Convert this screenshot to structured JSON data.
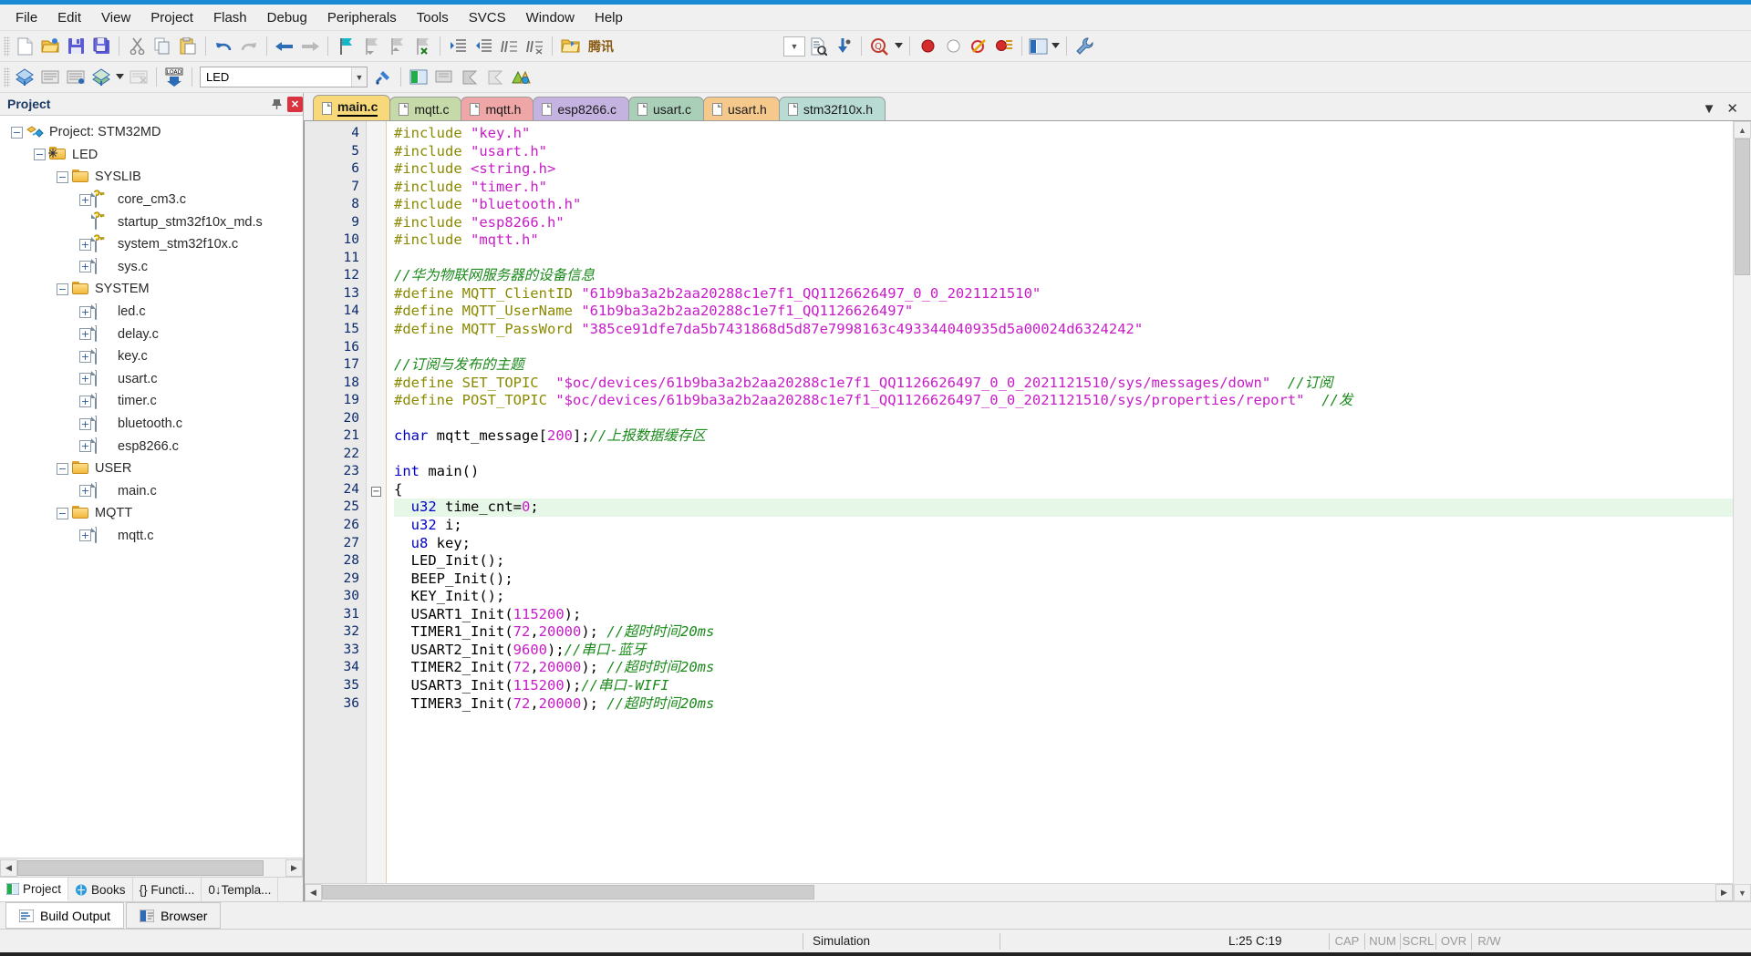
{
  "menubar": {
    "items": [
      {
        "label": "File"
      },
      {
        "label": "Edit"
      },
      {
        "label": "View"
      },
      {
        "label": "Project"
      },
      {
        "label": "Flash"
      },
      {
        "label": "Debug"
      },
      {
        "label": "Peripherals"
      },
      {
        "label": "Tools"
      },
      {
        "label": "SVCS"
      },
      {
        "label": "Window"
      },
      {
        "label": "Help"
      }
    ]
  },
  "toolbar1": {
    "icons": [
      "new-file-icon",
      "open-file-icon",
      "save-icon",
      "save-all-icon",
      "cut-icon",
      "copy-icon",
      "paste-icon",
      "undo-icon",
      "redo-icon",
      "navigate-back-icon",
      "navigate-forward-icon",
      "bookmark-toggle-icon",
      "bookmark-prev-icon",
      "bookmark-next-icon",
      "bookmark-clear-icon",
      "indent-icon",
      "outdent-icon",
      "comment-icon",
      "uncomment-icon"
    ],
    "tencent_label": "腾讯",
    "tencent_icon": "tencent-folder-icon",
    "find_combo_value": "",
    "find_in_files_icon": "find-in-files-icon",
    "bookmark-jump-icon": "goto-icon",
    "zoom_icon": "find-icon",
    "debug_icons": [
      "breakpoint-icon",
      "breakpoint-disable-icon",
      "breakpoint-kill-icon",
      "breakpoint-list-icon"
    ],
    "window_icon": "window-layout-icon",
    "config_icon": "configure-icon"
  },
  "toolbar2": {
    "icons": [
      "build-icon",
      "translate-icon",
      "build-target-icon",
      "rebuild-icon",
      "batch-build-icon",
      "download-icon"
    ],
    "target_value": "LED",
    "target_placeholder": "Select Target",
    "right_icons": [
      "project-window-icon",
      "books-icon",
      "functions-icon",
      "templates-icon",
      "manage-project-icon"
    ]
  },
  "project_panel": {
    "title": "Project",
    "pin_icon": "pin-icon",
    "close_icon": "close-icon",
    "tree": [
      {
        "depth": 0,
        "expander": "-",
        "icon": "project-icon",
        "label": "Project: STM32MD"
      },
      {
        "depth": 1,
        "expander": "-",
        "icon": "target-icon",
        "label": "LED"
      },
      {
        "depth": 2,
        "expander": "-",
        "icon": "folder-icon",
        "label": "SYSLIB"
      },
      {
        "depth": 3,
        "expander": "+",
        "icon": "source-key-icon",
        "label": "core_cm3.c"
      },
      {
        "depth": 3,
        "expander": "",
        "icon": "source-key-icon",
        "label": "startup_stm32f10x_md.s"
      },
      {
        "depth": 3,
        "expander": "+",
        "icon": "source-key-icon",
        "label": "system_stm32f10x.c"
      },
      {
        "depth": 3,
        "expander": "+",
        "icon": "source-icon",
        "label": "sys.c"
      },
      {
        "depth": 2,
        "expander": "-",
        "icon": "folder-icon",
        "label": "SYSTEM"
      },
      {
        "depth": 3,
        "expander": "+",
        "icon": "source-icon",
        "label": "led.c"
      },
      {
        "depth": 3,
        "expander": "+",
        "icon": "source-icon",
        "label": "delay.c"
      },
      {
        "depth": 3,
        "expander": "+",
        "icon": "source-icon",
        "label": "key.c"
      },
      {
        "depth": 3,
        "expander": "+",
        "icon": "source-icon",
        "label": "usart.c"
      },
      {
        "depth": 3,
        "expander": "+",
        "icon": "source-icon",
        "label": "timer.c"
      },
      {
        "depth": 3,
        "expander": "+",
        "icon": "source-icon",
        "label": "bluetooth.c"
      },
      {
        "depth": 3,
        "expander": "+",
        "icon": "source-icon",
        "label": "esp8266.c"
      },
      {
        "depth": 2,
        "expander": "-",
        "icon": "folder-icon",
        "label": "USER"
      },
      {
        "depth": 3,
        "expander": "+",
        "icon": "source-icon",
        "label": "main.c"
      },
      {
        "depth": 2,
        "expander": "-",
        "icon": "folder-icon",
        "label": "MQTT"
      },
      {
        "depth": 3,
        "expander": "+",
        "icon": "source-icon",
        "label": "mqtt.c"
      }
    ],
    "bottom_tabs": [
      {
        "label": "Project",
        "icon": "project-window-icon",
        "active": true
      },
      {
        "label": "Books",
        "icon": "books-icon",
        "active": false
      },
      {
        "label": "{} Functi...",
        "icon": "functions-icon",
        "active": false
      },
      {
        "label": "0↓Templa...",
        "icon": "templates-icon",
        "active": false
      }
    ]
  },
  "editor": {
    "tabs": [
      {
        "label": "main.c",
        "color": "#f7d97a",
        "active": true
      },
      {
        "label": "mqtt.c",
        "color": "#c6d9a8",
        "active": false
      },
      {
        "label": "mqtt.h",
        "color": "#eea6a6",
        "active": false
      },
      {
        "label": "esp8266.c",
        "color": "#c4b2e0",
        "active": false
      },
      {
        "label": "usart.c",
        "color": "#a9cfb8",
        "active": false
      },
      {
        "label": "usart.h",
        "color": "#f5c98c",
        "active": false
      },
      {
        "label": "stm32f10x.h",
        "color": "#b8dbd4",
        "active": false
      }
    ],
    "tab_close_icon": "close-icon",
    "tab_dropdown_icon": "chevron-down-icon",
    "first_line_number": 4,
    "lines": [
      {
        "n": 4,
        "fold": "",
        "cur": false,
        "tokens": [
          {
            "t": "#include ",
            "c": "k-pre"
          },
          {
            "t": "\"key.h\"",
            "c": "k-str"
          }
        ]
      },
      {
        "n": 5,
        "fold": "",
        "cur": false,
        "tokens": [
          {
            "t": "#include ",
            "c": "k-pre"
          },
          {
            "t": "\"usart.h\"",
            "c": "k-str"
          }
        ]
      },
      {
        "n": 6,
        "fold": "",
        "cur": false,
        "tokens": [
          {
            "t": "#include ",
            "c": "k-pre"
          },
          {
            "t": "<string.h>",
            "c": "k-str"
          }
        ]
      },
      {
        "n": 7,
        "fold": "",
        "cur": false,
        "tokens": [
          {
            "t": "#include ",
            "c": "k-pre"
          },
          {
            "t": "\"timer.h\"",
            "c": "k-str"
          }
        ]
      },
      {
        "n": 8,
        "fold": "",
        "cur": false,
        "tokens": [
          {
            "t": "#include ",
            "c": "k-pre"
          },
          {
            "t": "\"bluetooth.h\"",
            "c": "k-str"
          }
        ]
      },
      {
        "n": 9,
        "fold": "",
        "cur": false,
        "tokens": [
          {
            "t": "#include ",
            "c": "k-pre"
          },
          {
            "t": "\"esp8266.h\"",
            "c": "k-str"
          }
        ]
      },
      {
        "n": 10,
        "fold": "",
        "cur": false,
        "tokens": [
          {
            "t": "#include ",
            "c": "k-pre"
          },
          {
            "t": "\"mqtt.h\"",
            "c": "k-str"
          }
        ]
      },
      {
        "n": 11,
        "fold": "",
        "cur": false,
        "tokens": []
      },
      {
        "n": 12,
        "fold": "",
        "cur": false,
        "tokens": [
          {
            "t": "//华为物联网服务器的设备信息",
            "c": "k-cmt"
          }
        ]
      },
      {
        "n": 13,
        "fold": "",
        "cur": false,
        "tokens": [
          {
            "t": "#define MQTT_ClientID ",
            "c": "k-pre"
          },
          {
            "t": "\"61b9ba3a2b2aa20288c1e7f1_QQ1126626497_0_0_2021121510\"",
            "c": "k-str"
          }
        ]
      },
      {
        "n": 14,
        "fold": "",
        "cur": false,
        "tokens": [
          {
            "t": "#define MQTT_UserName ",
            "c": "k-pre"
          },
          {
            "t": "\"61b9ba3a2b2aa20288c1e7f1_QQ1126626497\"",
            "c": "k-str"
          }
        ]
      },
      {
        "n": 15,
        "fold": "",
        "cur": false,
        "tokens": [
          {
            "t": "#define MQTT_PassWord ",
            "c": "k-pre"
          },
          {
            "t": "\"385ce91dfe7da5b7431868d5d87e7998163c493344040935d5a00024d6324242\"",
            "c": "k-str"
          }
        ]
      },
      {
        "n": 16,
        "fold": "",
        "cur": false,
        "tokens": []
      },
      {
        "n": 17,
        "fold": "",
        "cur": false,
        "tokens": [
          {
            "t": "//订阅与发布的主题",
            "c": "k-cmt"
          }
        ]
      },
      {
        "n": 18,
        "fold": "",
        "cur": false,
        "tokens": [
          {
            "t": "#define SET_TOPIC  ",
            "c": "k-pre"
          },
          {
            "t": "\"$oc/devices/61b9ba3a2b2aa20288c1e7f1_QQ1126626497_0_0_2021121510/sys/messages/down\"",
            "c": "k-str"
          },
          {
            "t": "  ",
            "c": "k-txt"
          },
          {
            "t": "//订阅",
            "c": "k-cmt"
          }
        ]
      },
      {
        "n": 19,
        "fold": "",
        "cur": false,
        "tokens": [
          {
            "t": "#define POST_TOPIC ",
            "c": "k-pre"
          },
          {
            "t": "\"$oc/devices/61b9ba3a2b2aa20288c1e7f1_QQ1126626497_0_0_2021121510/sys/properties/report\"",
            "c": "k-str"
          },
          {
            "t": "  ",
            "c": "k-txt"
          },
          {
            "t": "//发",
            "c": "k-cmt"
          }
        ]
      },
      {
        "n": 20,
        "fold": "",
        "cur": false,
        "tokens": []
      },
      {
        "n": 21,
        "fold": "",
        "cur": false,
        "tokens": [
          {
            "t": "char",
            "c": "k-kw"
          },
          {
            "t": " mqtt_message[",
            "c": "k-txt"
          },
          {
            "t": "200",
            "c": "k-num"
          },
          {
            "t": "];",
            "c": "k-txt"
          },
          {
            "t": "//上报数据缓存区",
            "c": "k-cmt"
          }
        ]
      },
      {
        "n": 22,
        "fold": "",
        "cur": false,
        "tokens": []
      },
      {
        "n": 23,
        "fold": "",
        "cur": false,
        "tokens": [
          {
            "t": "int",
            "c": "k-kw"
          },
          {
            "t": " main()",
            "c": "k-txt"
          }
        ]
      },
      {
        "n": 24,
        "fold": "-",
        "cur": false,
        "tokens": [
          {
            "t": "{",
            "c": "k-txt"
          }
        ]
      },
      {
        "n": 25,
        "fold": "",
        "cur": true,
        "tokens": [
          {
            "t": "  ",
            "c": "k-txt"
          },
          {
            "t": "u32",
            "c": "k-kw"
          },
          {
            "t": " time_cnt=",
            "c": "k-txt"
          },
          {
            "t": "0",
            "c": "k-num"
          },
          {
            "t": ";",
            "c": "k-txt"
          }
        ]
      },
      {
        "n": 26,
        "fold": "",
        "cur": false,
        "tokens": [
          {
            "t": "  ",
            "c": "k-txt"
          },
          {
            "t": "u32",
            "c": "k-kw"
          },
          {
            "t": " i;",
            "c": "k-txt"
          }
        ]
      },
      {
        "n": 27,
        "fold": "",
        "cur": false,
        "tokens": [
          {
            "t": "  ",
            "c": "k-txt"
          },
          {
            "t": "u8",
            "c": "k-kw"
          },
          {
            "t": " key;",
            "c": "k-txt"
          }
        ]
      },
      {
        "n": 28,
        "fold": "",
        "cur": false,
        "tokens": [
          {
            "t": "  LED_Init();",
            "c": "k-txt"
          }
        ]
      },
      {
        "n": 29,
        "fold": "",
        "cur": false,
        "tokens": [
          {
            "t": "  BEEP_Init();",
            "c": "k-txt"
          }
        ]
      },
      {
        "n": 30,
        "fold": "",
        "cur": false,
        "tokens": [
          {
            "t": "  KEY_Init();",
            "c": "k-txt"
          }
        ]
      },
      {
        "n": 31,
        "fold": "",
        "cur": false,
        "tokens": [
          {
            "t": "  USART1_Init(",
            "c": "k-txt"
          },
          {
            "t": "115200",
            "c": "k-num"
          },
          {
            "t": ");",
            "c": "k-txt"
          }
        ]
      },
      {
        "n": 32,
        "fold": "",
        "cur": false,
        "tokens": [
          {
            "t": "  TIMER1_Init(",
            "c": "k-txt"
          },
          {
            "t": "72",
            "c": "k-num"
          },
          {
            "t": ",",
            "c": "k-txt"
          },
          {
            "t": "20000",
            "c": "k-num"
          },
          {
            "t": "); ",
            "c": "k-txt"
          },
          {
            "t": "//超时时间20ms",
            "c": "k-cmt"
          }
        ]
      },
      {
        "n": 33,
        "fold": "",
        "cur": false,
        "tokens": [
          {
            "t": "  USART2_Init(",
            "c": "k-txt"
          },
          {
            "t": "9600",
            "c": "k-num"
          },
          {
            "t": ");",
            "c": "k-txt"
          },
          {
            "t": "//串口-蓝牙",
            "c": "k-cmt"
          }
        ]
      },
      {
        "n": 34,
        "fold": "",
        "cur": false,
        "tokens": [
          {
            "t": "  TIMER2_Init(",
            "c": "k-txt"
          },
          {
            "t": "72",
            "c": "k-num"
          },
          {
            "t": ",",
            "c": "k-txt"
          },
          {
            "t": "20000",
            "c": "k-num"
          },
          {
            "t": "); ",
            "c": "k-txt"
          },
          {
            "t": "//超时时间20ms",
            "c": "k-cmt"
          }
        ]
      },
      {
        "n": 35,
        "fold": "",
        "cur": false,
        "tokens": [
          {
            "t": "  USART3_Init(",
            "c": "k-txt"
          },
          {
            "t": "115200",
            "c": "k-num"
          },
          {
            "t": ");",
            "c": "k-txt"
          },
          {
            "t": "//串口-WIFI",
            "c": "k-cmt"
          }
        ]
      },
      {
        "n": 36,
        "fold": "",
        "cur": false,
        "tokens": [
          {
            "t": "  TIMER3_Init(",
            "c": "k-txt"
          },
          {
            "t": "72",
            "c": "k-num"
          },
          {
            "t": ",",
            "c": "k-txt"
          },
          {
            "t": "20000",
            "c": "k-num"
          },
          {
            "t": "); ",
            "c": "k-txt"
          },
          {
            "t": "//超时时间20ms",
            "c": "k-cmt"
          }
        ]
      }
    ]
  },
  "bottom_panel": {
    "tabs": [
      {
        "label": "Build Output",
        "icon": "build-output-icon",
        "active": true
      },
      {
        "label": "Browser",
        "icon": "browser-icon",
        "active": false
      }
    ]
  },
  "statusbar": {
    "message": "",
    "mode": "Simulation",
    "cursor": "L:25 C:19",
    "flags": [
      "CAP",
      "NUM",
      "SCRL",
      "OVR",
      "R/W"
    ]
  }
}
